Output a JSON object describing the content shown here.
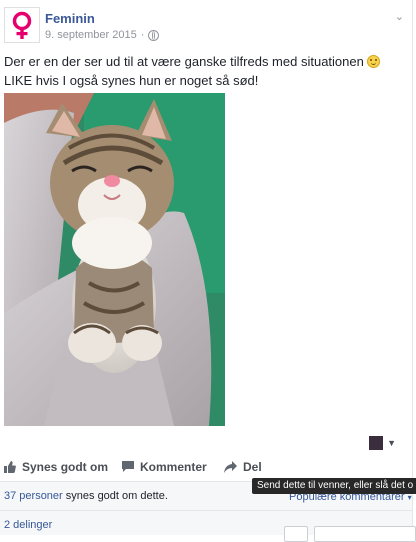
{
  "post": {
    "page_name": "Feminin",
    "date": "9. september 2015",
    "privacy_icon": "globe-icon",
    "text_part1": "Der er en der ser ud til at være ganske tilfreds med situationen",
    "text_part2": "LIKE hvis I også synes hun er noget så sød!",
    "logo_color": "#e5006d"
  },
  "actions": {
    "like_label": "Synes godt om",
    "comment_label": "Kommenter",
    "share_label": "Del"
  },
  "tooltip": {
    "text": "Send dette til venner, eller slå det o"
  },
  "footer": {
    "likes_link": "37 personer",
    "likes_rest": " synes godt om dette.",
    "popular_label": "Populære kommentarer",
    "shares_label": "2 delinger"
  },
  "colors": {
    "link": "#365899",
    "page_name": "#3b5998",
    "muted": "#90949c"
  }
}
